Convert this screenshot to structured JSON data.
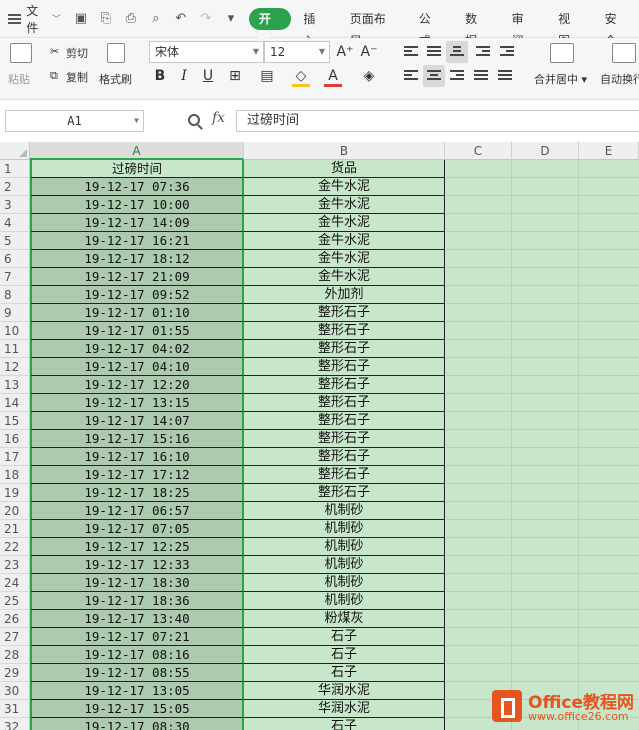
{
  "menubar": {
    "file_label": "文件",
    "tabs": [
      "开始",
      "插入",
      "页面布局",
      "公式",
      "数据",
      "审阅",
      "视图",
      "安全"
    ],
    "active_tab": "开始"
  },
  "toolbar": {
    "paste_label": "粘贴",
    "cut_label": "剪切",
    "copy_label": "复制",
    "format_painter_label": "格式刷",
    "font_name": "宋体",
    "font_size": "12",
    "bold_label": "B",
    "italic_label": "I",
    "underline_label": "U",
    "font_color_label": "A",
    "grow_font_label": "A⁺",
    "shrink_font_label": "A⁻",
    "merge_center_label": "合并居中",
    "auto_wrap_label": "自动换行",
    "font_color": "#e53935",
    "fill_color": "#f5c518"
  },
  "formula_bar": {
    "cell_ref": "A1",
    "fx_label": "fx",
    "content": "过磅时间"
  },
  "grid": {
    "columns": [
      "A",
      "B",
      "C",
      "D",
      "E"
    ],
    "selected_column": "A",
    "header_row": [
      "过磅时间",
      "货品"
    ],
    "rows": [
      [
        "19-12-17 07:36",
        "金牛水泥"
      ],
      [
        "19-12-17 10:00",
        "金牛水泥"
      ],
      [
        "19-12-17 14:09",
        "金牛水泥"
      ],
      [
        "19-12-17 16:21",
        "金牛水泥"
      ],
      [
        "19-12-17 18:12",
        "金牛水泥"
      ],
      [
        "19-12-17 21:09",
        "金牛水泥"
      ],
      [
        "19-12-17 09:52",
        "外加剂"
      ],
      [
        "19-12-17 01:10",
        "整形石子"
      ],
      [
        "19-12-17 01:55",
        "整形石子"
      ],
      [
        "19-12-17 04:02",
        "整形石子"
      ],
      [
        "19-12-17 04:10",
        "整形石子"
      ],
      [
        "19-12-17 12:20",
        "整形石子"
      ],
      [
        "19-12-17 13:15",
        "整形石子"
      ],
      [
        "19-12-17 14:07",
        "整形石子"
      ],
      [
        "19-12-17 15:16",
        "整形石子"
      ],
      [
        "19-12-17 16:10",
        "整形石子"
      ],
      [
        "19-12-17 17:12",
        "整形石子"
      ],
      [
        "19-12-17 18:25",
        "整形石子"
      ],
      [
        "19-12-17 06:57",
        "机制砂"
      ],
      [
        "19-12-17 07:05",
        "机制砂"
      ],
      [
        "19-12-17 12:25",
        "机制砂"
      ],
      [
        "19-12-17 12:33",
        "机制砂"
      ],
      [
        "19-12-17 18:30",
        "机制砂"
      ],
      [
        "19-12-17 18:36",
        "机制砂"
      ],
      [
        "19-12-17 13:40",
        "粉煤灰"
      ],
      [
        "19-12-17 07:21",
        "石子"
      ],
      [
        "19-12-17 08:16",
        "石子"
      ],
      [
        "19-12-17 08:55",
        "石子"
      ],
      [
        "19-12-17 13:05",
        "华润水泥"
      ],
      [
        "19-12-17 15:05",
        "华润水泥"
      ],
      [
        "19-12-17 08:30",
        "石子"
      ]
    ]
  },
  "watermark": {
    "title": "Office教程网",
    "url": "www.office26.com"
  }
}
